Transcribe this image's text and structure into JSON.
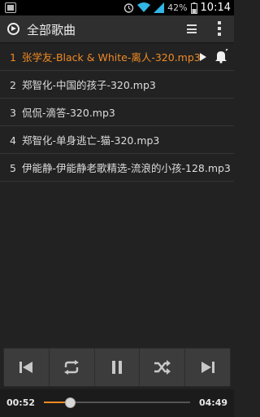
{
  "status_bar": {
    "battery_percent": "42%",
    "time": "10:14",
    "icons": [
      "notification-icon",
      "alarm-icon",
      "wifi-icon",
      "signal-icon",
      "battery-icon"
    ]
  },
  "action_bar": {
    "app_icon": "play-circle-icon",
    "title": "全部歌曲",
    "list_icon": "playlist-icon",
    "overflow_icon": "overflow-menu-icon"
  },
  "playlist": [
    {
      "num": "1",
      "title": "张学友-Black & White-离人-320.mp3",
      "active": true
    },
    {
      "num": "2",
      "title": "郑智化-中国的孩子-320.mp3",
      "active": false
    },
    {
      "num": "3",
      "title": "侃侃-滴答-320.mp3",
      "active": false
    },
    {
      "num": "4",
      "title": "郑智化-单身逃亡-猫-320.mp3",
      "active": false
    },
    {
      "num": "5",
      "title": "伊能静-伊能静老歌精选-流浪的小孩-128.mp3",
      "active": false
    }
  ],
  "controls": [
    "previous-icon",
    "repeat-icon",
    "pause-icon",
    "shuffle-icon",
    "next-icon"
  ],
  "progress": {
    "current": "00:52",
    "total": "04:49",
    "fraction": 0.18
  },
  "colors": {
    "accent": "#f08a24",
    "background": "#222222",
    "text": "#dddddd"
  }
}
